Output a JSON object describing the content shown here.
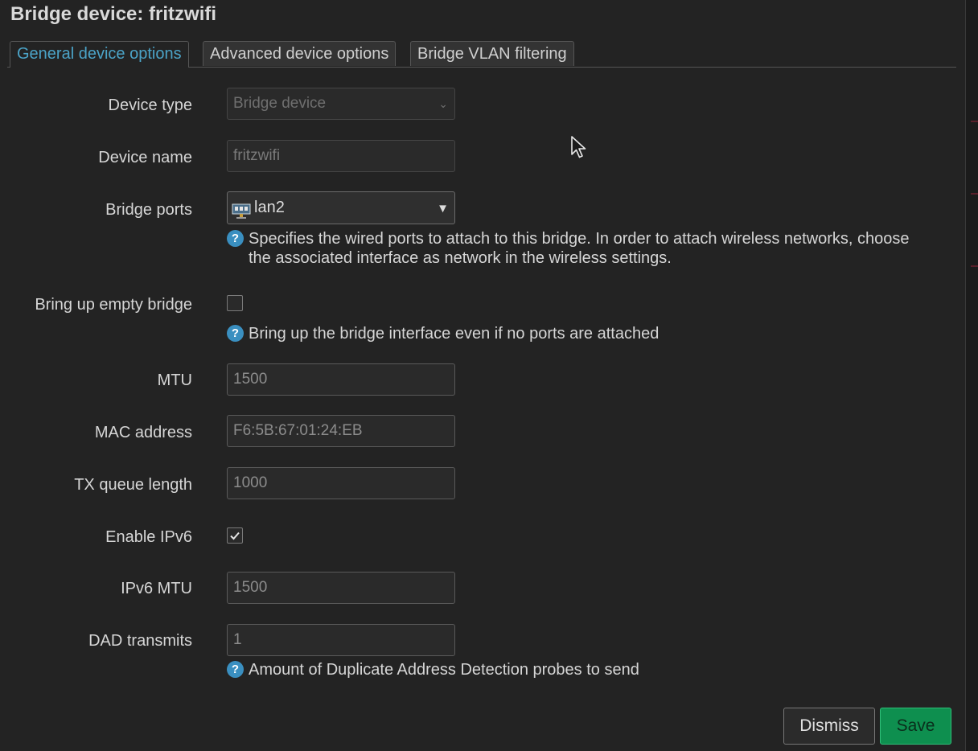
{
  "dialog": {
    "title": "Bridge device: fritzwifi"
  },
  "tabs": [
    {
      "label": "General device options",
      "active": true
    },
    {
      "label": "Advanced device options",
      "active": false
    },
    {
      "label": "Bridge VLAN filtering",
      "active": false
    }
  ],
  "fields": {
    "device_type": {
      "label": "Device type",
      "value": "Bridge device"
    },
    "device_name": {
      "label": "Device name",
      "value": "fritzwifi"
    },
    "bridge_ports": {
      "label": "Bridge ports",
      "value": "lan2",
      "help_line1": "Specifies the wired ports to attach to this bridge. In order to attach wireless networks, choose",
      "help_line2": "the associated interface as network in the wireless settings."
    },
    "bring_up_empty": {
      "label": "Bring up empty bridge",
      "checked": false,
      "help": "Bring up the bridge interface even if no ports are attached"
    },
    "mtu": {
      "label": "MTU",
      "placeholder": "1500"
    },
    "mac_address": {
      "label": "MAC address",
      "placeholder": "F6:5B:67:01:24:EB"
    },
    "tx_queue_length": {
      "label": "TX queue length",
      "placeholder": "1000"
    },
    "enable_ipv6": {
      "label": "Enable IPv6",
      "checked": true
    },
    "ipv6_mtu": {
      "label": "IPv6 MTU",
      "placeholder": "1500"
    },
    "dad_transmits": {
      "label": "DAD transmits",
      "placeholder": "1",
      "help": "Amount of Duplicate Address Detection probes to send"
    }
  },
  "help_glyph": "?",
  "buttons": {
    "dismiss": "Dismiss",
    "save": "Save"
  },
  "colors": {
    "accent": "#4ba3c7",
    "save": "#0e8f4f",
    "background": "#232323"
  }
}
